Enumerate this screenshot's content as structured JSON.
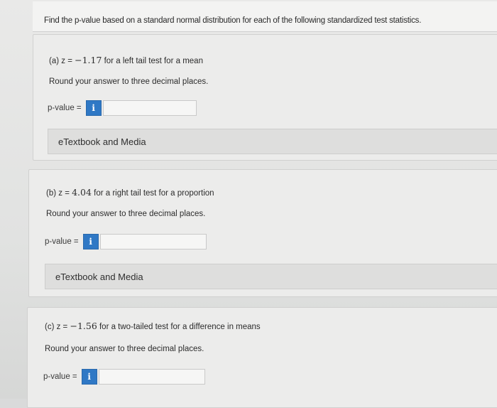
{
  "intro": "Find the p-value based on a standard normal distribution for each of the following standardized test statistics.",
  "parts": [
    {
      "prefix": "(a) z = ",
      "z": "−1.17",
      "description": " for a left tail test for a mean",
      "round_text": "Round your answer to three decimal places.",
      "pvalue_label": "p-value =",
      "info_icon": "i",
      "answer": "",
      "media_label": "eTextbook and Media"
    },
    {
      "prefix": "(b) z = ",
      "z": "4.04",
      "description": " for a right tail test for a proportion",
      "round_text": "Round your answer to three decimal places.",
      "pvalue_label": "p-value =",
      "info_icon": "i",
      "answer": "",
      "media_label": "eTextbook and Media"
    },
    {
      "prefix": "(c) z = ",
      "z": "−1.56",
      "description": " for a two-tailed test for a difference in means",
      "round_text": "Round your answer to three decimal places.",
      "pvalue_label": "p-value =",
      "info_icon": "i",
      "answer": ""
    }
  ],
  "colors": {
    "info_button": "#2f78c5",
    "background": "#e4e4e3"
  },
  "icons": [
    "info-icon"
  ]
}
